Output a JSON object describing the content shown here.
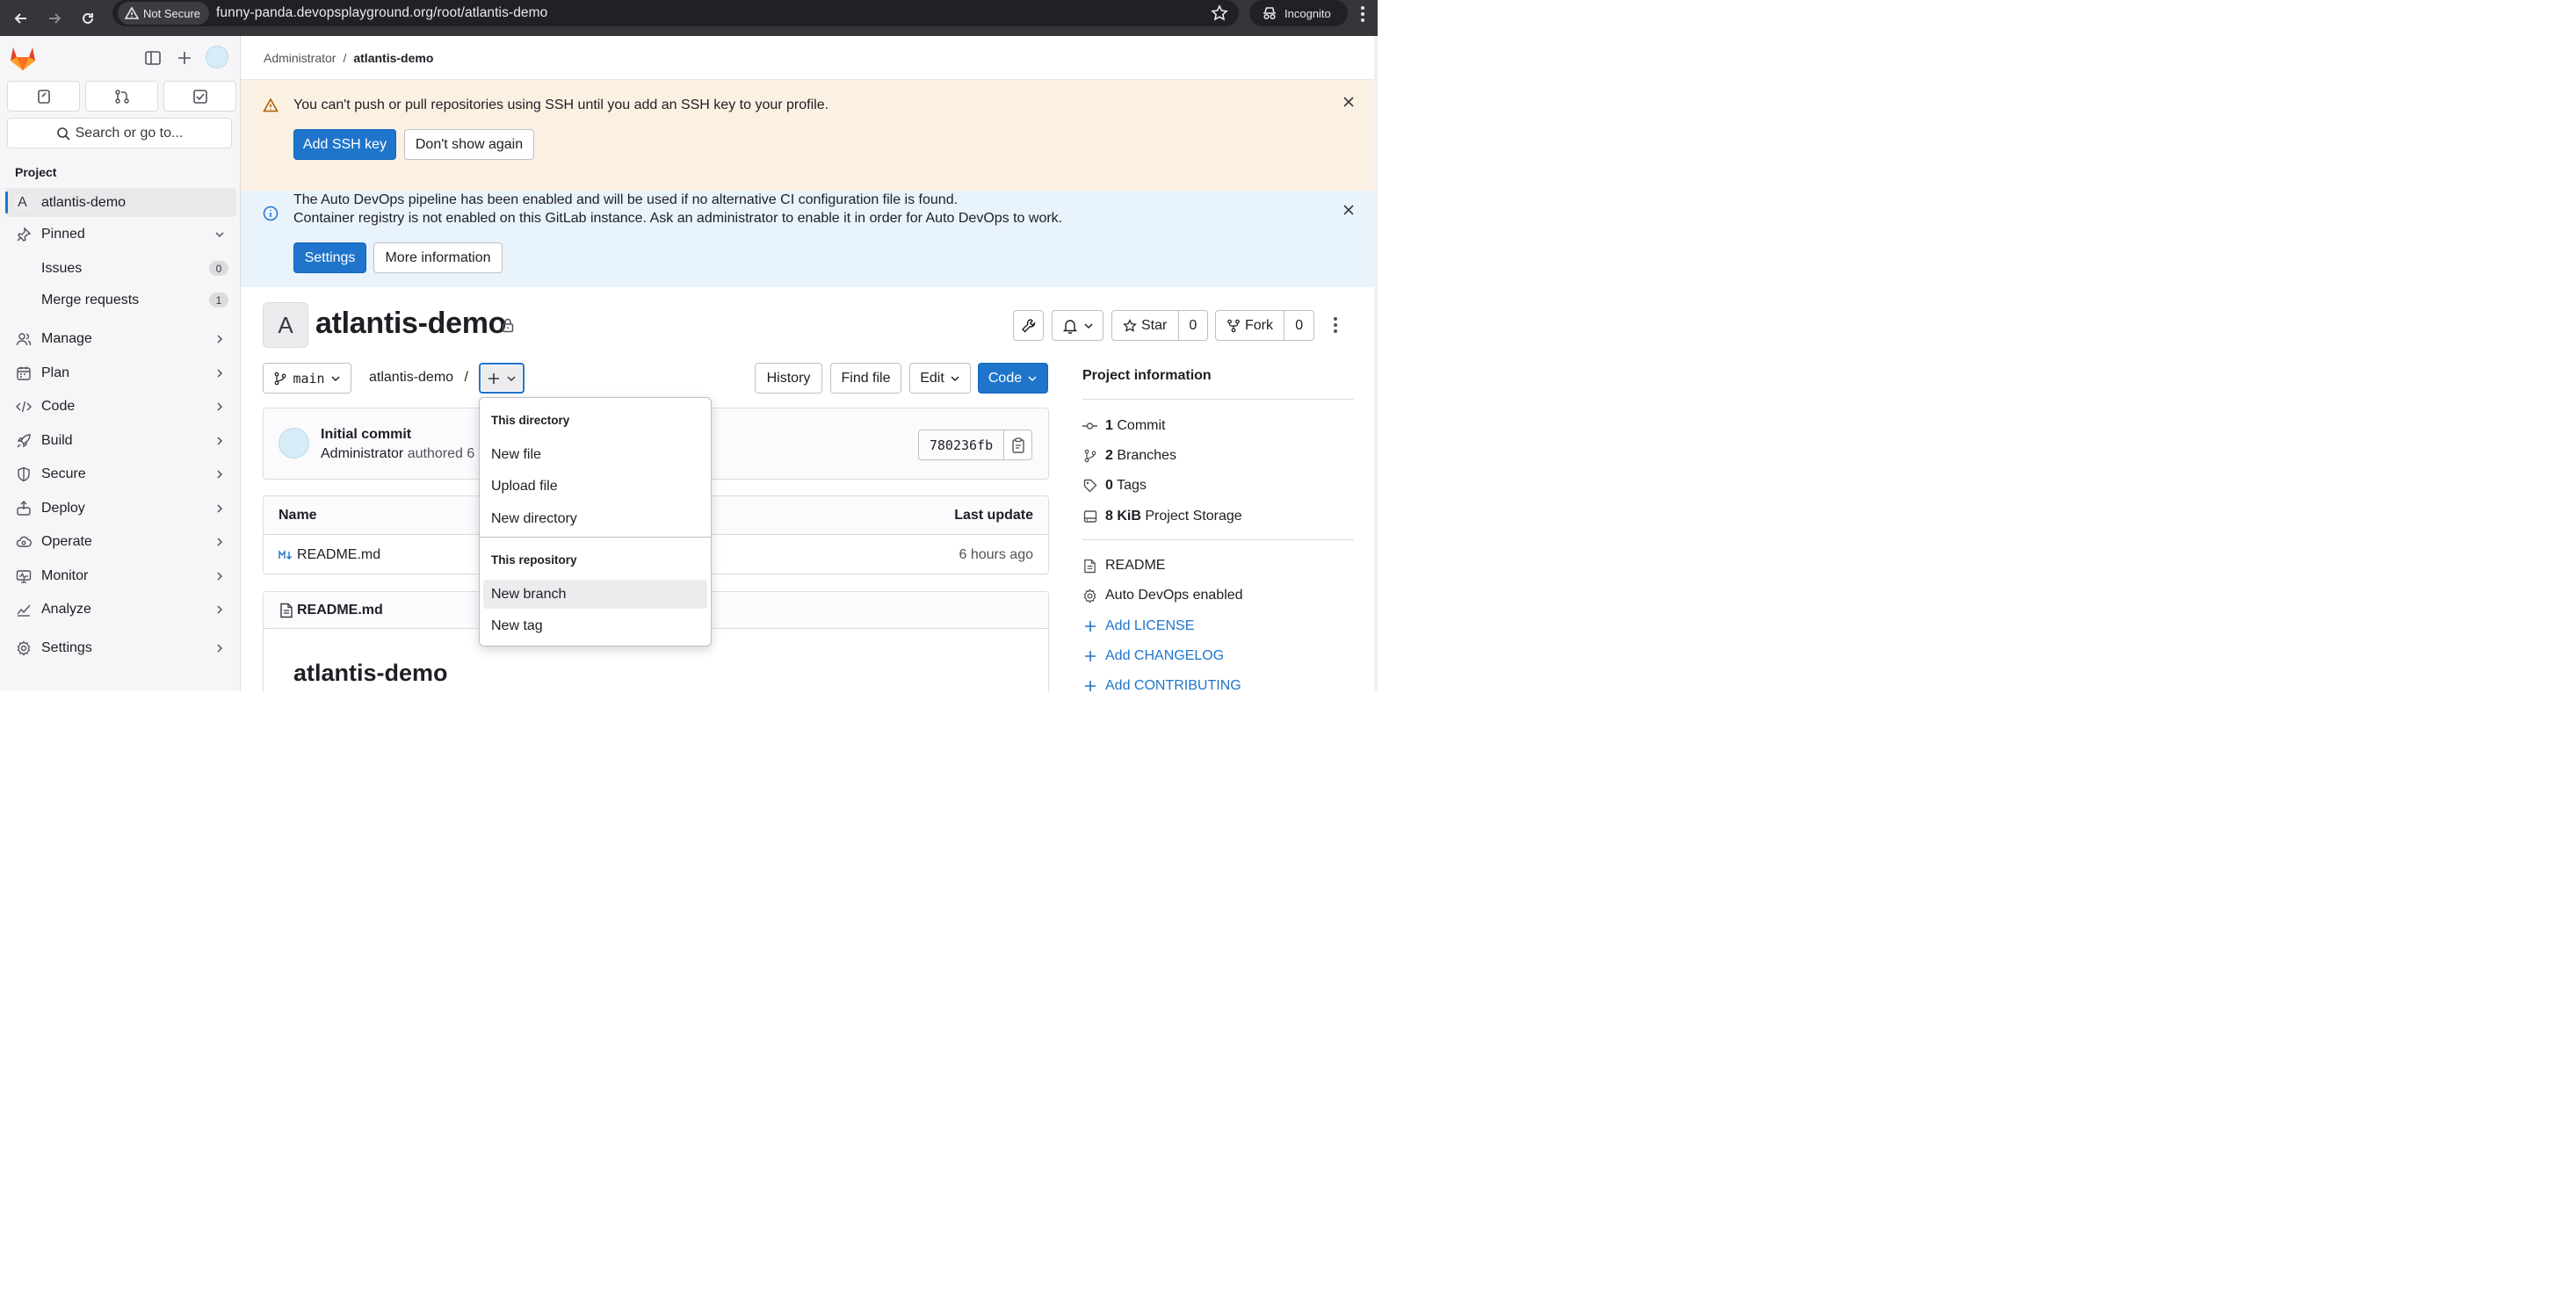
{
  "browser": {
    "security_label": "Not Secure",
    "url": "funny-panda.devopsplayground.org/root/atlantis-demo",
    "profile_label": "Incognito"
  },
  "sidebar": {
    "search_label": "Search or go to...",
    "section_title": "Project",
    "project_letter": "A",
    "project_name": "atlantis-demo",
    "pinned_label": "Pinned",
    "pinned_items": [
      {
        "label": "Issues",
        "count": "0"
      },
      {
        "label": "Merge requests",
        "count": "1"
      }
    ],
    "nav_items": [
      {
        "label": "Manage",
        "icon": "users-icon"
      },
      {
        "label": "Plan",
        "icon": "calendar-icon"
      },
      {
        "label": "Code",
        "icon": "code-icon"
      },
      {
        "label": "Build",
        "icon": "rocket-icon"
      },
      {
        "label": "Secure",
        "icon": "shield-icon"
      },
      {
        "label": "Deploy",
        "icon": "deploy-icon"
      },
      {
        "label": "Operate",
        "icon": "cloud-gear-icon"
      },
      {
        "label": "Monitor",
        "icon": "monitor-icon"
      },
      {
        "label": "Analyze",
        "icon": "chart-icon"
      },
      {
        "label": "Settings",
        "icon": "gear-icon"
      }
    ]
  },
  "breadcrumb": {
    "parent": "Administrator",
    "separator": "/",
    "current": "atlantis-demo"
  },
  "ssh_alert": {
    "message": "You can't push or pull repositories using SSH until you add an SSH key to your profile.",
    "primary": "Add SSH key",
    "secondary": "Don't show again"
  },
  "devops_alert": {
    "line1": "The Auto DevOps pipeline has been enabled and will be used if no alternative CI configuration file is found.",
    "line2": "Container registry is not enabled on this GitLab instance. Ask an administrator to enable it in order for Auto DevOps to work.",
    "primary": "Settings",
    "secondary": "More information"
  },
  "project": {
    "letter": "A",
    "title": "atlantis-demo",
    "star_label": "Star",
    "star_count": "0",
    "fork_label": "Fork",
    "fork_count": "0"
  },
  "toolbar": {
    "branch": "main",
    "path": "atlantis-demo",
    "path_sep": "/",
    "history": "History",
    "find_file": "Find file",
    "edit": "Edit",
    "code": "Code"
  },
  "commit": {
    "title": "Initial commit",
    "author": "Administrator",
    "authored": "authored 6",
    "sha": "780236fb"
  },
  "files": {
    "col_name": "Name",
    "col_update": "Last update",
    "rows": [
      {
        "name": "README.md",
        "updated": "6 hours ago"
      }
    ]
  },
  "readme": {
    "filename": "README.md",
    "heading": "atlantis-demo"
  },
  "add_dropdown": {
    "group1_title": "This directory",
    "group1_items": [
      "New file",
      "Upload file",
      "New directory"
    ],
    "group2_title": "This repository",
    "group2_items": [
      "New branch",
      "New tag"
    ],
    "hovered_item": "New branch"
  },
  "project_info": {
    "title": "Project information",
    "stats": [
      {
        "value": "1",
        "label": "Commit"
      },
      {
        "value": "2",
        "label": "Branches"
      },
      {
        "value": "0",
        "label": "Tags"
      },
      {
        "value": "8 KiB",
        "label": "Project Storage"
      }
    ],
    "readme": "README",
    "autodevops": "Auto DevOps enabled",
    "add_links": [
      "Add LICENSE",
      "Add CHANGELOG",
      "Add CONTRIBUTING"
    ]
  },
  "colors": {
    "primary_blue": "#1f75cb",
    "warning_bg": "#fbf1e3",
    "info_bg": "#e9f3fc",
    "sidebar_bg": "#f6f6f8",
    "gitlab_orange": "#e24329"
  }
}
